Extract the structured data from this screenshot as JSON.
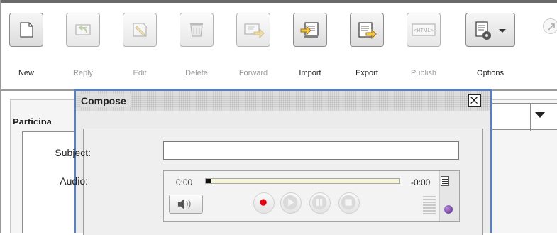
{
  "toolbar": {
    "buttons": [
      {
        "id": "new",
        "label": "New",
        "icon": "new-document-icon",
        "enabled": true
      },
      {
        "id": "reply",
        "label": "Reply",
        "icon": "reply-icon",
        "enabled": false
      },
      {
        "id": "edit",
        "label": "Edit",
        "icon": "edit-pencil-icon",
        "enabled": false
      },
      {
        "id": "delete",
        "label": "Delete",
        "icon": "trash-icon",
        "enabled": false
      },
      {
        "id": "forward",
        "label": "Forward",
        "icon": "forward-icon",
        "enabled": false
      },
      {
        "id": "import",
        "label": "Import",
        "icon": "import-icon",
        "enabled": true
      },
      {
        "id": "export",
        "label": "Export",
        "icon": "export-icon",
        "enabled": true
      },
      {
        "id": "publish",
        "label": "Publish",
        "icon": "html-publish-icon",
        "enabled": false,
        "badge_text": "<HTML>"
      },
      {
        "id": "options",
        "label": "Options",
        "icon": "options-gear-icon",
        "enabled": true
      }
    ],
    "help_icon": "help-arrow-icon"
  },
  "background": {
    "participants_heading": "Participa"
  },
  "compose_dialog": {
    "title": "Compose",
    "close_icon": "close-icon",
    "subject": {
      "label": "Subject:",
      "value": ""
    },
    "audio": {
      "label": "Audio:",
      "elapsed": "0:00",
      "remaining": "-0:00",
      "progress": 0.0,
      "controls": [
        {
          "name": "speaker",
          "icon": "speaker-icon"
        },
        {
          "name": "record",
          "icon": "record-icon"
        },
        {
          "name": "play",
          "icon": "play-icon"
        },
        {
          "name": "pause",
          "icon": "pause-icon"
        },
        {
          "name": "stop",
          "icon": "stop-icon"
        }
      ]
    }
  },
  "colors": {
    "dialog_border": "#5a7fbc",
    "record_red": "#e30613",
    "track_fill": "#f7f5d8"
  }
}
